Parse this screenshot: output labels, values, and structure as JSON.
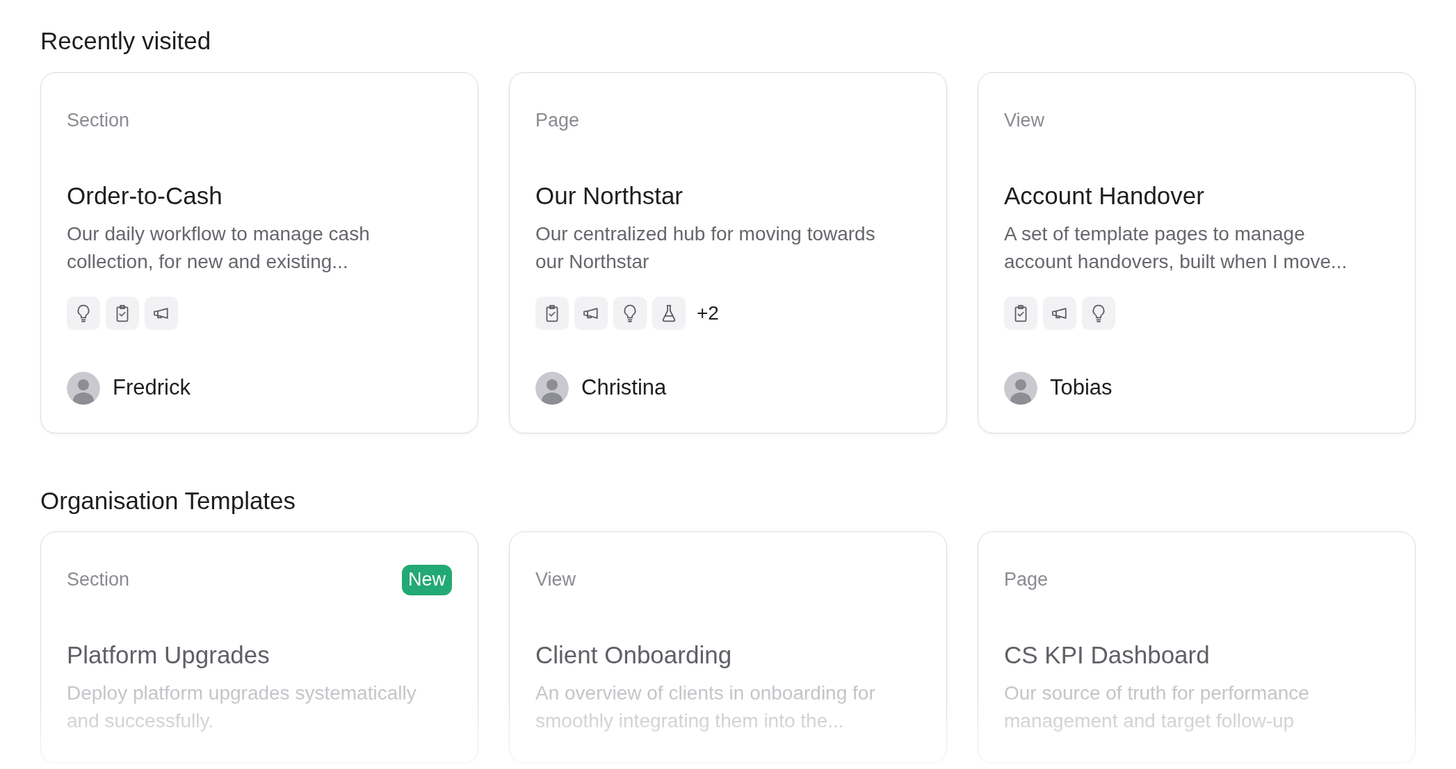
{
  "sections": [
    {
      "title": "Recently visited",
      "faded": false,
      "cards": [
        {
          "type": "Section",
          "title": "Order-to-Cash",
          "description": "Our daily workflow to manage cash collection, for new and existing...",
          "tags": [
            {
              "kind": "bulb"
            },
            {
              "kind": "clipboard"
            },
            {
              "kind": "megaphone"
            }
          ],
          "owner": "Fredrick"
        },
        {
          "type": "Page",
          "title": "Our Northstar",
          "description": "Our centralized hub for moving towards our Northstar",
          "tags": [
            {
              "kind": "clipboard"
            },
            {
              "kind": "megaphone"
            },
            {
              "kind": "bulb"
            },
            {
              "kind": "flask"
            }
          ],
          "more": "+2",
          "owner": "Christina"
        },
        {
          "type": "View",
          "title": "Account Handover",
          "description": "A set of template pages to manage account handovers, built when I move...",
          "tags": [
            {
              "kind": "clipboard"
            },
            {
              "kind": "megaphone"
            },
            {
              "kind": "bulb"
            }
          ],
          "owner": "Tobias"
        }
      ]
    },
    {
      "title": "Organisation Templates",
      "faded": true,
      "cards": [
        {
          "type": "Section",
          "badge": "New",
          "title": "Platform Upgrades",
          "description": "Deploy platform upgrades systematically and successfully."
        },
        {
          "type": "View",
          "title": "Client Onboarding",
          "description": "An overview of clients in onboarding for smoothly integrating them into the..."
        },
        {
          "type": "Page",
          "title": "CS KPI Dashboard",
          "description": "Our source of truth for performance management and target follow-up"
        }
      ]
    }
  ]
}
